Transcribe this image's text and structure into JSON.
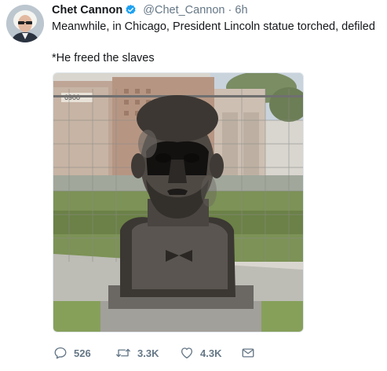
{
  "tweet": {
    "author_name": "Chet Cannon",
    "handle": "@Chet_Cannon",
    "separator": "·",
    "time": "6h",
    "text_line1": "Meanwhile, in Chicago, President Lincoln statue torched, defiled",
    "text_line2": "*He freed the slaves",
    "image_sign_text": "6900",
    "icons": {
      "verified": "verified-badge-icon",
      "reply": "reply-icon",
      "retweet": "retweet-icon",
      "like": "heart-icon",
      "message": "envelope-icon"
    }
  },
  "actions": {
    "reply_count": "526",
    "retweet_count": "3.3K",
    "like_count": "4.3K"
  },
  "colors": {
    "text": "#14171a",
    "muted": "#657786",
    "verified": "#1da1f2"
  }
}
